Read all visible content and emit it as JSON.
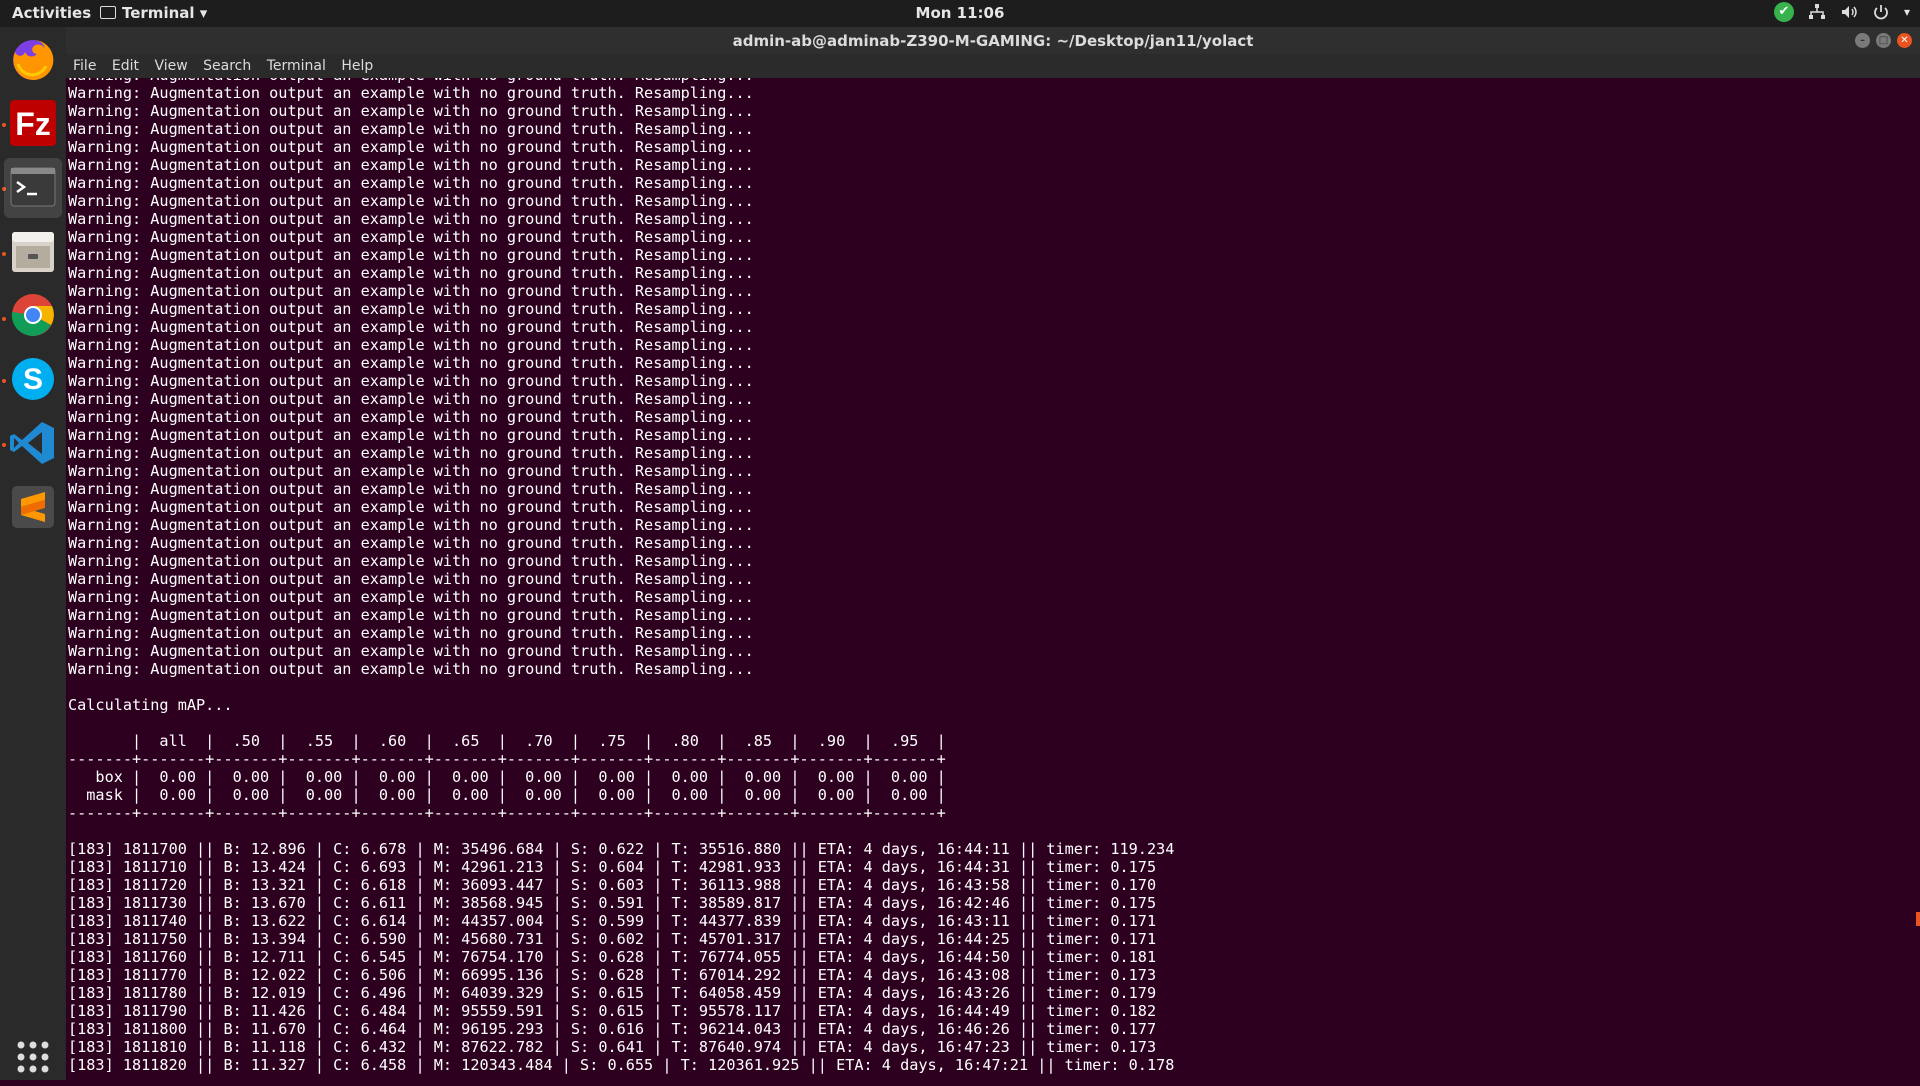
{
  "topbar": {
    "activities": "Activities",
    "app_menu": "Terminal",
    "clock": "Mon 11:06"
  },
  "window": {
    "title": "admin-ab@adminab-Z390-M-GAMING: ~/Desktop/jan11/yolact"
  },
  "menubar": [
    "File",
    "Edit",
    "View",
    "Search",
    "Terminal",
    "Help"
  ],
  "dock": [
    "firefox-icon",
    "filezilla-icon",
    "terminal-icon",
    "files-icon",
    "chrome-icon",
    "skype-icon",
    "vscode-icon",
    "sublime-text-icon",
    "show-apps-icon"
  ],
  "terminal": {
    "warning_line": "Warning: Augmentation output an example with no ground truth. Resampling...",
    "warning_count": 34,
    "calc_line": "Calculating mAP...",
    "table_header": "       |  all  |  .50  |  .55  |  .60  |  .65  |  .70  |  .75  |  .80  |  .85  |  .90  |  .95  |",
    "table_sep": "-------+-------+-------+-------+-------+-------+-------+-------+-------+-------+-------+-------+",
    "table_rows": [
      "   box |  0.00 |  0.00 |  0.00 |  0.00 |  0.00 |  0.00 |  0.00 |  0.00 |  0.00 |  0.00 |  0.00 |",
      "  mask |  0.00 |  0.00 |  0.00 |  0.00 |  0.00 |  0.00 |  0.00 |  0.00 |  0.00 |  0.00 |  0.00 |"
    ],
    "log_lines": [
      "[183] 1811700 || B: 12.896 | C: 6.678 | M: 35496.684 | S: 0.622 | T: 35516.880 || ETA: 4 days, 16:44:11 || timer: 119.234",
      "[183] 1811710 || B: 13.424 | C: 6.693 | M: 42961.213 | S: 0.604 | T: 42981.933 || ETA: 4 days, 16:44:31 || timer: 0.175",
      "[183] 1811720 || B: 13.321 | C: 6.618 | M: 36093.447 | S: 0.603 | T: 36113.988 || ETA: 4 days, 16:43:58 || timer: 0.170",
      "[183] 1811730 || B: 13.670 | C: 6.611 | M: 38568.945 | S: 0.591 | T: 38589.817 || ETA: 4 days, 16:42:46 || timer: 0.175",
      "[183] 1811740 || B: 13.622 | C: 6.614 | M: 44357.004 | S: 0.599 | T: 44377.839 || ETA: 4 days, 16:43:11 || timer: 0.171",
      "[183] 1811750 || B: 13.394 | C: 6.590 | M: 45680.731 | S: 0.602 | T: 45701.317 || ETA: 4 days, 16:44:25 || timer: 0.171",
      "[183] 1811760 || B: 12.711 | C: 6.545 | M: 76754.170 | S: 0.628 | T: 76774.055 || ETA: 4 days, 16:44:50 || timer: 0.181",
      "[183] 1811770 || B: 12.022 | C: 6.506 | M: 66995.136 | S: 0.628 | T: 67014.292 || ETA: 4 days, 16:43:08 || timer: 0.173",
      "[183] 1811780 || B: 12.019 | C: 6.496 | M: 64039.329 | S: 0.615 | T: 64058.459 || ETA: 4 days, 16:43:26 || timer: 0.179",
      "[183] 1811790 || B: 11.426 | C: 6.484 | M: 95559.591 | S: 0.615 | T: 95578.117 || ETA: 4 days, 16:44:49 || timer: 0.182",
      "[183] 1811800 || B: 11.670 | C: 6.464 | M: 96195.293 | S: 0.616 | T: 96214.043 || ETA: 4 days, 16:46:26 || timer: 0.177",
      "[183] 1811810 || B: 11.118 | C: 6.432 | M: 87622.782 | S: 0.641 | T: 87640.974 || ETA: 4 days, 16:47:23 || timer: 0.173",
      "[183] 1811820 || B: 11.327 | C: 6.458 | M: 120343.484 | S: 0.655 | T: 120361.925 || ETA: 4 days, 16:47:21 || timer: 0.178"
    ]
  },
  "colors": {
    "terminal_bg": "#2c001e",
    "accent": "#e95420"
  }
}
